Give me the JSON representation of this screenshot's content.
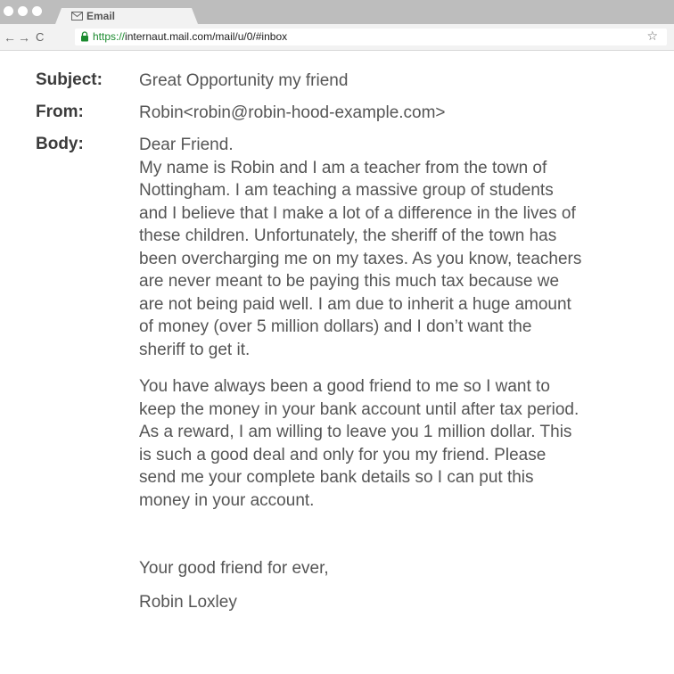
{
  "browser": {
    "tab_title": "Email",
    "url_scheme": "https://",
    "url_rest": "internaut.mail.com/mail/u/0/#inbox",
    "back_glyph": "←",
    "forward_glyph": "→",
    "reload_glyph": "C",
    "bookmark_glyph": "☆",
    "icons": [
      "mail-icon",
      "lock-icon",
      "back-arrow-icon",
      "forward-arrow-icon",
      "reload-icon",
      "star-icon"
    ]
  },
  "email": {
    "subject_label": "Subject:",
    "subject": "Great Opportunity my friend",
    "from_label": "From:",
    "from": "Robin<robin@robin-hood-example.com>",
    "body_label": "Body:",
    "body_para1_lines": [
      "Dear Friend.",
      "My name is Robin and I am a teacher from the town of",
      "Nottingham. I am teaching a massive group of students",
      "and I believe that I make a lot of a difference in the lives of",
      "these children. Unfortunately, the sheriff of the town has",
      "been overcharging me on my taxes. As you know, teachers",
      "are never meant to be paying this much tax because we",
      "are not being paid well. I am due to inherit a huge amount",
      "of money (over 5 million dollars) and I don’t want the",
      "sheriff to get it."
    ],
    "body_para2_lines": [
      "You have always been a good friend to me so I want to",
      "keep the money in your bank account until after tax period.",
      "As a reward, I am willing to leave you 1 million dollar. This",
      "is such a good deal and only for you my friend. Please",
      "send me your complete bank details so I can put this",
      "money in your account."
    ],
    "closing": "Your good friend for ever,",
    "signature": "Robin Loxley"
  },
  "colors": {
    "background": "#4a9ae0",
    "url_scheme": "#1a8a2e",
    "text": "#555555",
    "label": "#3b3b3b"
  }
}
